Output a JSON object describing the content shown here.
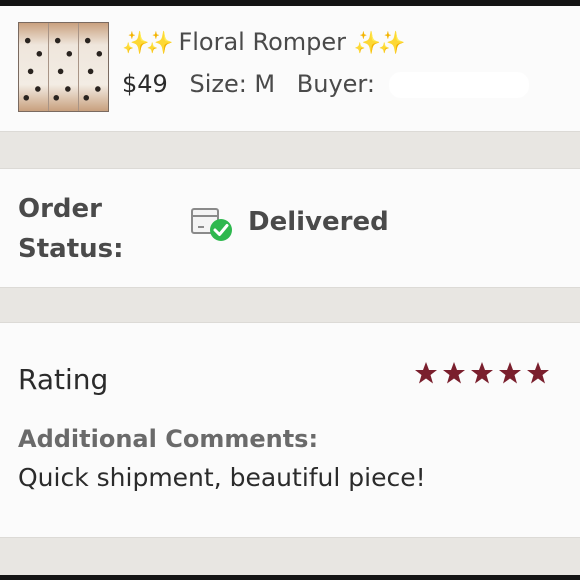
{
  "product": {
    "title_sparkles_left": "✨✨",
    "title": "Floral Romper",
    "title_sparkles_right": "✨✨",
    "price": "$49",
    "size": "Size: M",
    "buyer_label": "Buyer: ",
    "buyer_redacted": true
  },
  "order_status": {
    "label_line1": "Order",
    "label_line2": "Status:",
    "value": "Delivered",
    "icon": "package-delivered-icon",
    "icon_check_color": "#2eb84e"
  },
  "rating": {
    "label": "Rating",
    "stars": 5,
    "max_stars": 5,
    "star_color": "#7a1f2d",
    "comments_heading": "Additional Comments:",
    "comments_text": "Quick shipment, beautiful piece!"
  }
}
